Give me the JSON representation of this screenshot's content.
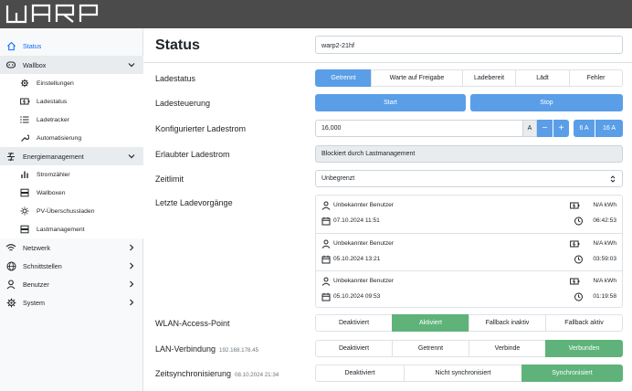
{
  "app": {
    "logo_text": "WARP"
  },
  "sidebar": {
    "status": "Status",
    "wallbox": "Wallbox",
    "wallbox_items": [
      "Einstellungen",
      "Ladestatus",
      "Ladetracker",
      "Automatisierung"
    ],
    "energy": "Energiemanagement",
    "energy_items": [
      "Stromzähler",
      "Wallboxen",
      "PV-Überschussladen",
      "Lastmanagement"
    ],
    "network": "Netzwerk",
    "interfaces": "Schnittstellen",
    "users": "Benutzer",
    "system": "System"
  },
  "main": {
    "title": "Status",
    "hostname": "warp2-21hf",
    "ladestatus": {
      "label": "Ladestatus",
      "options": [
        "Getrennt",
        "Warte auf Freigabe",
        "Ladebereit",
        "Lädt",
        "Fehler"
      ],
      "selected": "Getrennt"
    },
    "ladesteuerung": {
      "label": "Ladesteuerung",
      "start": "Start",
      "stop": "Stop"
    },
    "konfig": {
      "label": "Konfigurierter Ladestrom",
      "value": "16,000",
      "unit": "A",
      "minus": "−",
      "plus": "+",
      "preset_6": "6 A",
      "preset_16": "16 A"
    },
    "erlaubt": {
      "label": "Erlaubter Ladestrom",
      "value": "Blockiert durch Lastmanagement"
    },
    "zeitlimit": {
      "label": "Zeitlimit",
      "value": "Unbegrenzt"
    },
    "charges": {
      "label": "Letzte Ladevorgänge",
      "items": [
        {
          "user": "Unbekannter Benutzer",
          "date": "07.10.2024 11:51",
          "energy": "N/A kWh",
          "duration": "06:42:53"
        },
        {
          "user": "Unbekannter Benutzer",
          "date": "05.10.2024 13:21",
          "energy": "N/A kWh",
          "duration": "03:59:03"
        },
        {
          "user": "Unbekannter Benutzer",
          "date": "05.10.2024 09:53",
          "energy": "N/A kWh",
          "duration": "01:19:58"
        }
      ]
    },
    "wlan": {
      "label": "WLAN-Access-Point",
      "options": [
        "Deaktiviert",
        "Aktiviert",
        "Fallback inaktiv",
        "Fallback aktiv"
      ],
      "selected": "Aktiviert"
    },
    "lan": {
      "label": "LAN-Verbindung",
      "ip": "192.168.178.45",
      "options": [
        "Deaktiviert",
        "Getrennt",
        "Verbinde",
        "Verbunden"
      ],
      "selected": "Verbunden"
    },
    "time": {
      "label": "Zeitsynchronisierung",
      "stamp": "08.10.2024 21:34",
      "options": [
        "Deaktiviert",
        "Nicht synchronisiert",
        "Synchronisiert"
      ],
      "selected": "Synchronisiert"
    }
  },
  "colors": {
    "topbar": "#4b4b4b",
    "primary": "#5a9ee8",
    "success": "#5fb37a",
    "active_nav": "#0d6efd"
  }
}
